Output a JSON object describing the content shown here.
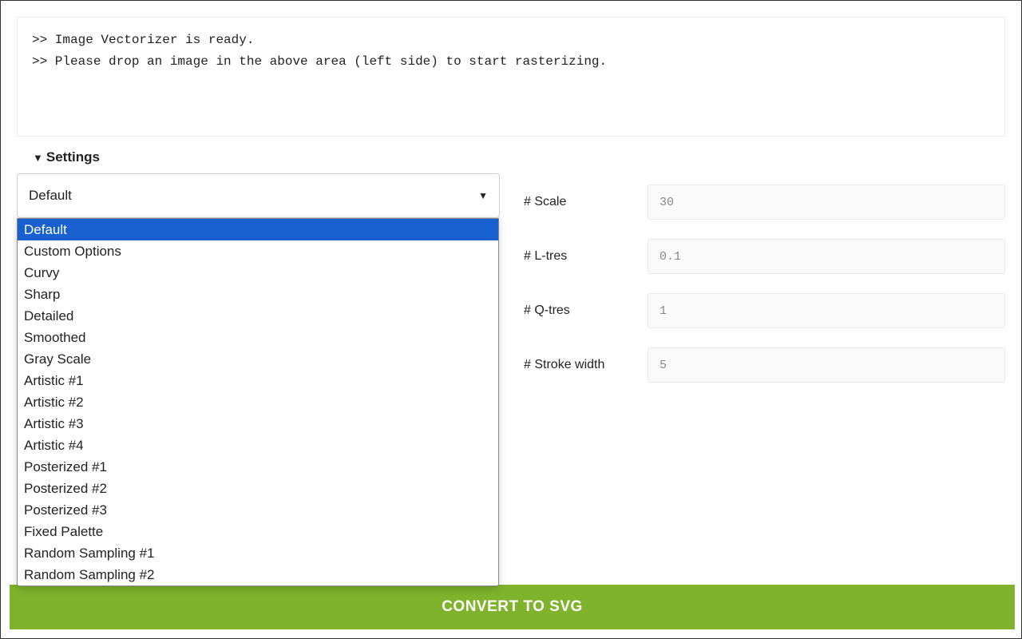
{
  "console": {
    "line1": ">> Image Vectorizer is ready.",
    "line2": ">> Please drop an image in the above area (left side) to start rasterizing."
  },
  "settings": {
    "header_caret": "▼",
    "header_label": "Settings",
    "preset_selected": "Default",
    "preset_options": [
      "Default",
      "Custom Options",
      "Curvy",
      "Sharp",
      "Detailed",
      "Smoothed",
      "Gray Scale",
      "Artistic #1",
      "Artistic #2",
      "Artistic #3",
      "Artistic #4",
      "Posterized #1",
      "Posterized #2",
      "Posterized #3",
      "Fixed Palette",
      "Random Sampling #1",
      "Random Sampling #2"
    ],
    "fields": {
      "scale": {
        "label": "# Scale",
        "value": "30"
      },
      "ltres": {
        "label": "# L-tres",
        "value": "0.1"
      },
      "qtres": {
        "label": "# Q-tres",
        "value": "1"
      },
      "strokewidth": {
        "label": "# Stroke width",
        "value": "5"
      }
    }
  },
  "convert_button": "CONVERT TO SVG",
  "icons": {
    "select_caret": "▼"
  }
}
